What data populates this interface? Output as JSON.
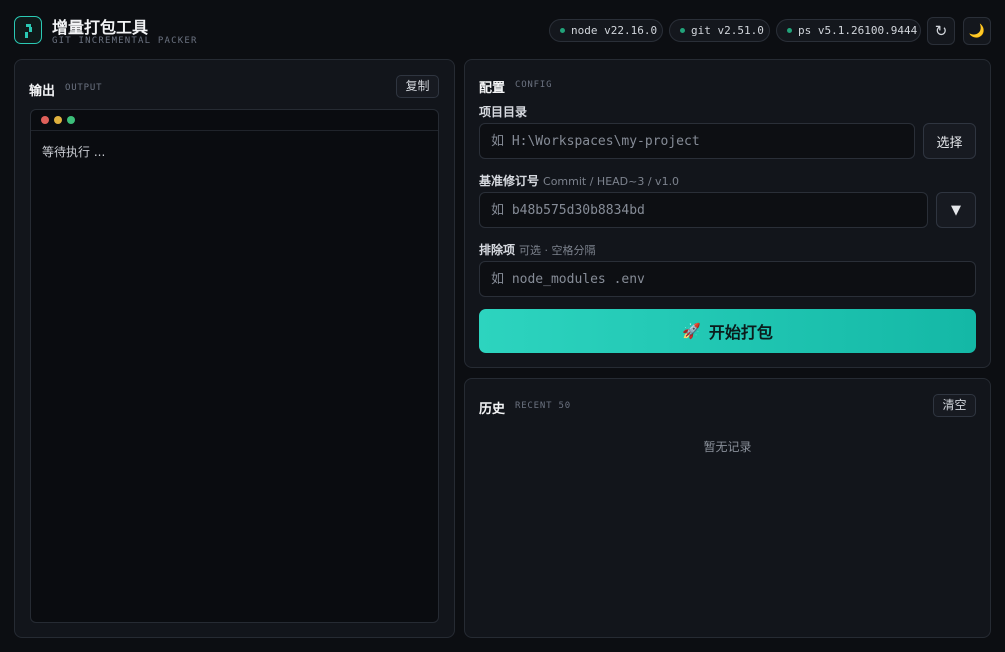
{
  "header": {
    "title": "增量打包工具",
    "subtitle": "GIT INCREMENTAL PACKER",
    "pills": {
      "node": "node v22.16.0",
      "git": "git v2.51.0",
      "ps": "ps v5.1.26100.9444"
    },
    "refresh_glyph": "↻",
    "theme_glyph": "🌙"
  },
  "output": {
    "title": "输出",
    "tag": "OUTPUT",
    "copy_label": "复制",
    "terminal_text": "等待执行 ..."
  },
  "config": {
    "title": "配置",
    "tag": "CONFIG",
    "project_dir": {
      "label": "项目目录",
      "placeholder": "如 H:\\Workspaces\\my-project",
      "choose_label": "选择"
    },
    "base_revision": {
      "label": "基准修订号",
      "hint": "Commit / HEAD~3 / v1.0",
      "placeholder": "如 b48b575d30b8834bd",
      "dropdown_glyph": "▼"
    },
    "exclude": {
      "label": "排除项",
      "hint": "可选 · 空格分隔",
      "placeholder": "如 node_modules .env"
    },
    "start_label": "开始打包",
    "start_icon": "🚀"
  },
  "history": {
    "title": "历史",
    "tag": "RECENT 50",
    "clear_label": "清空",
    "empty_text": "暂无记录"
  },
  "colors": {
    "accent": "#2dd4bf",
    "status_dot": "#22a37a",
    "background": "#0c0e12",
    "panel": "#12151b"
  }
}
